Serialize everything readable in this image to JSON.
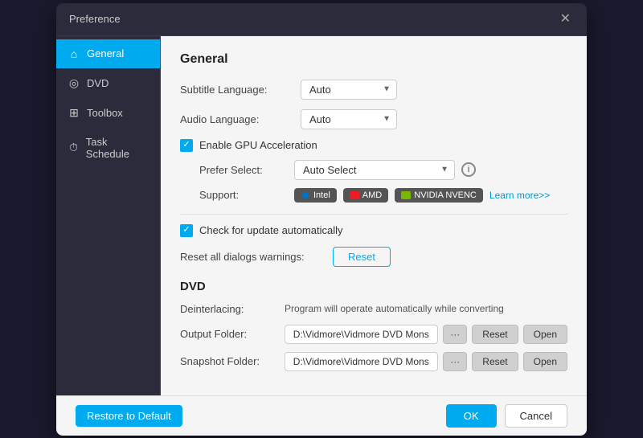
{
  "titleBar": {
    "title": "Preference",
    "closeLabel": "✕"
  },
  "sidebar": {
    "items": [
      {
        "id": "general",
        "label": "General",
        "icon": "⌂",
        "active": true
      },
      {
        "id": "dvd",
        "label": "DVD",
        "icon": "◎"
      },
      {
        "id": "toolbox",
        "label": "Toolbox",
        "icon": "⊞"
      },
      {
        "id": "task-schedule",
        "label": "Task Schedule",
        "icon": "⏱"
      }
    ]
  },
  "main": {
    "sectionTitle": "General",
    "subtitleLanguageLabel": "Subtitle Language:",
    "subtitleLanguageValue": "Auto",
    "audioLanguageLabel": "Audio Language:",
    "audioLanguageValue": "Auto",
    "gpuAcceleration": {
      "checkboxLabel": "Enable GPU Acceleration",
      "preferSelectLabel": "Prefer Select:",
      "preferSelectValue": "Auto Select",
      "supportLabel": "Support:",
      "supportBadges": [
        "Intel",
        "AMD",
        "NVIDIA NVENC"
      ],
      "learnMoreLabel": "Learn more>>"
    },
    "checkForUpdate": {
      "checkboxLabel": "Check for update automatically"
    },
    "resetDialogs": {
      "label": "Reset all dialogs warnings:",
      "buttonLabel": "Reset"
    },
    "dvdSection": {
      "title": "DVD",
      "deinterlacingLabel": "Deinterlacing:",
      "deinterlacingValue": "Program will operate automatically while converting",
      "outputFolderLabel": "Output Folder:",
      "outputFolderValue": "D:\\Vidmore\\Vidmore DVD Monster\\Riper",
      "snapshotFolderLabel": "Snapshot Folder:",
      "snapshotFolderValue": "D:\\Vidmore\\Vidmore DVD Monster\\Snapshot",
      "dotsLabel": "···",
      "resetLabel": "Reset",
      "openLabel": "Open"
    }
  },
  "footer": {
    "restoreLabel": "Restore to Default",
    "okLabel": "OK",
    "cancelLabel": "Cancel"
  },
  "colors": {
    "accent": "#00aaee",
    "sidebarBg": "#2b2b3b",
    "contentBg": "#f5f5f5"
  }
}
